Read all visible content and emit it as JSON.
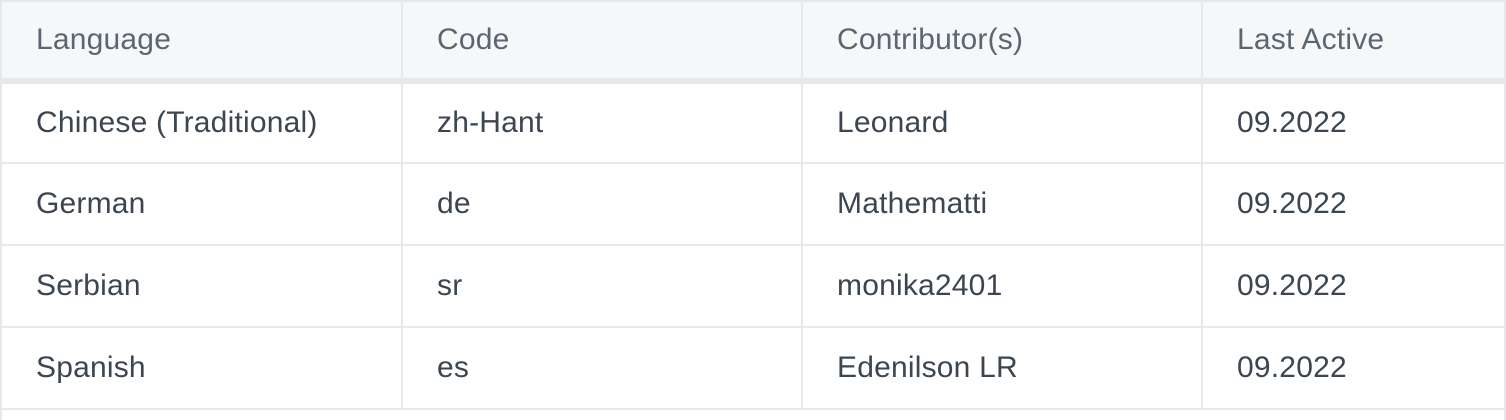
{
  "table": {
    "columns": [
      "Language",
      "Code",
      "Contributor(s)",
      "Last Active"
    ],
    "rows": [
      [
        "Chinese (Traditional)",
        "zh-Hant",
        "Leonard",
        "09.2022"
      ],
      [
        "German",
        "de",
        "Mathematti",
        "09.2022"
      ],
      [
        "Serbian",
        "sr",
        "monika2401",
        "09.2022"
      ],
      [
        "Spanish",
        "es",
        "Edenilson LR",
        "09.2022"
      ]
    ]
  },
  "colors": {
    "header_bg": "#f6f7f9",
    "header_text": "#5b6670",
    "cell_text": "#3c4650",
    "border": "#e6e8eb"
  }
}
